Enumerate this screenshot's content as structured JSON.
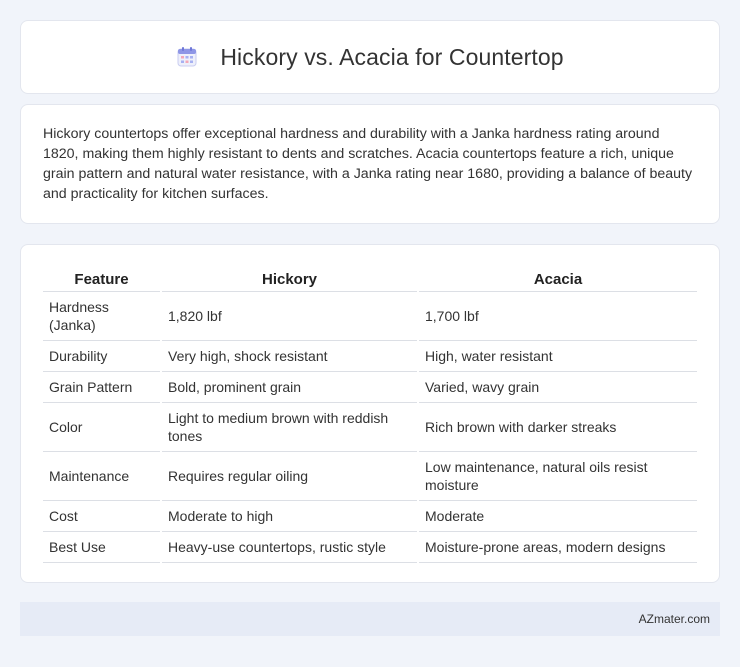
{
  "header": {
    "title": "Hickory vs. Acacia for Countertop",
    "icon": "calendar-icon"
  },
  "summary": {
    "text": "Hickory countertops offer exceptional hardness and durability with a Janka hardness rating around 1820, making them highly resistant to dents and scratches. Acacia countertops feature a rich, unique grain pattern and natural water resistance, with a Janka rating near 1680, providing a balance of beauty and practicality for kitchen surfaces."
  },
  "table": {
    "headers": [
      "Feature",
      "Hickory",
      "Acacia"
    ],
    "rows": [
      [
        "Hardness (Janka)",
        "1,820 lbf",
        "1,700 lbf"
      ],
      [
        "Durability",
        "Very high, shock resistant",
        "High, water resistant"
      ],
      [
        "Grain Pattern",
        "Bold, prominent grain",
        "Varied, wavy grain"
      ],
      [
        "Color",
        "Light to medium brown with reddish tones",
        "Rich brown with darker streaks"
      ],
      [
        "Maintenance",
        "Requires regular oiling",
        "Low maintenance, natural oils resist moisture"
      ],
      [
        "Cost",
        "Moderate to high",
        "Moderate"
      ],
      [
        "Best Use",
        "Heavy-use countertops, rustic style",
        "Moisture-prone areas, modern designs"
      ]
    ]
  },
  "footer": {
    "site": "AZmater.com"
  }
}
